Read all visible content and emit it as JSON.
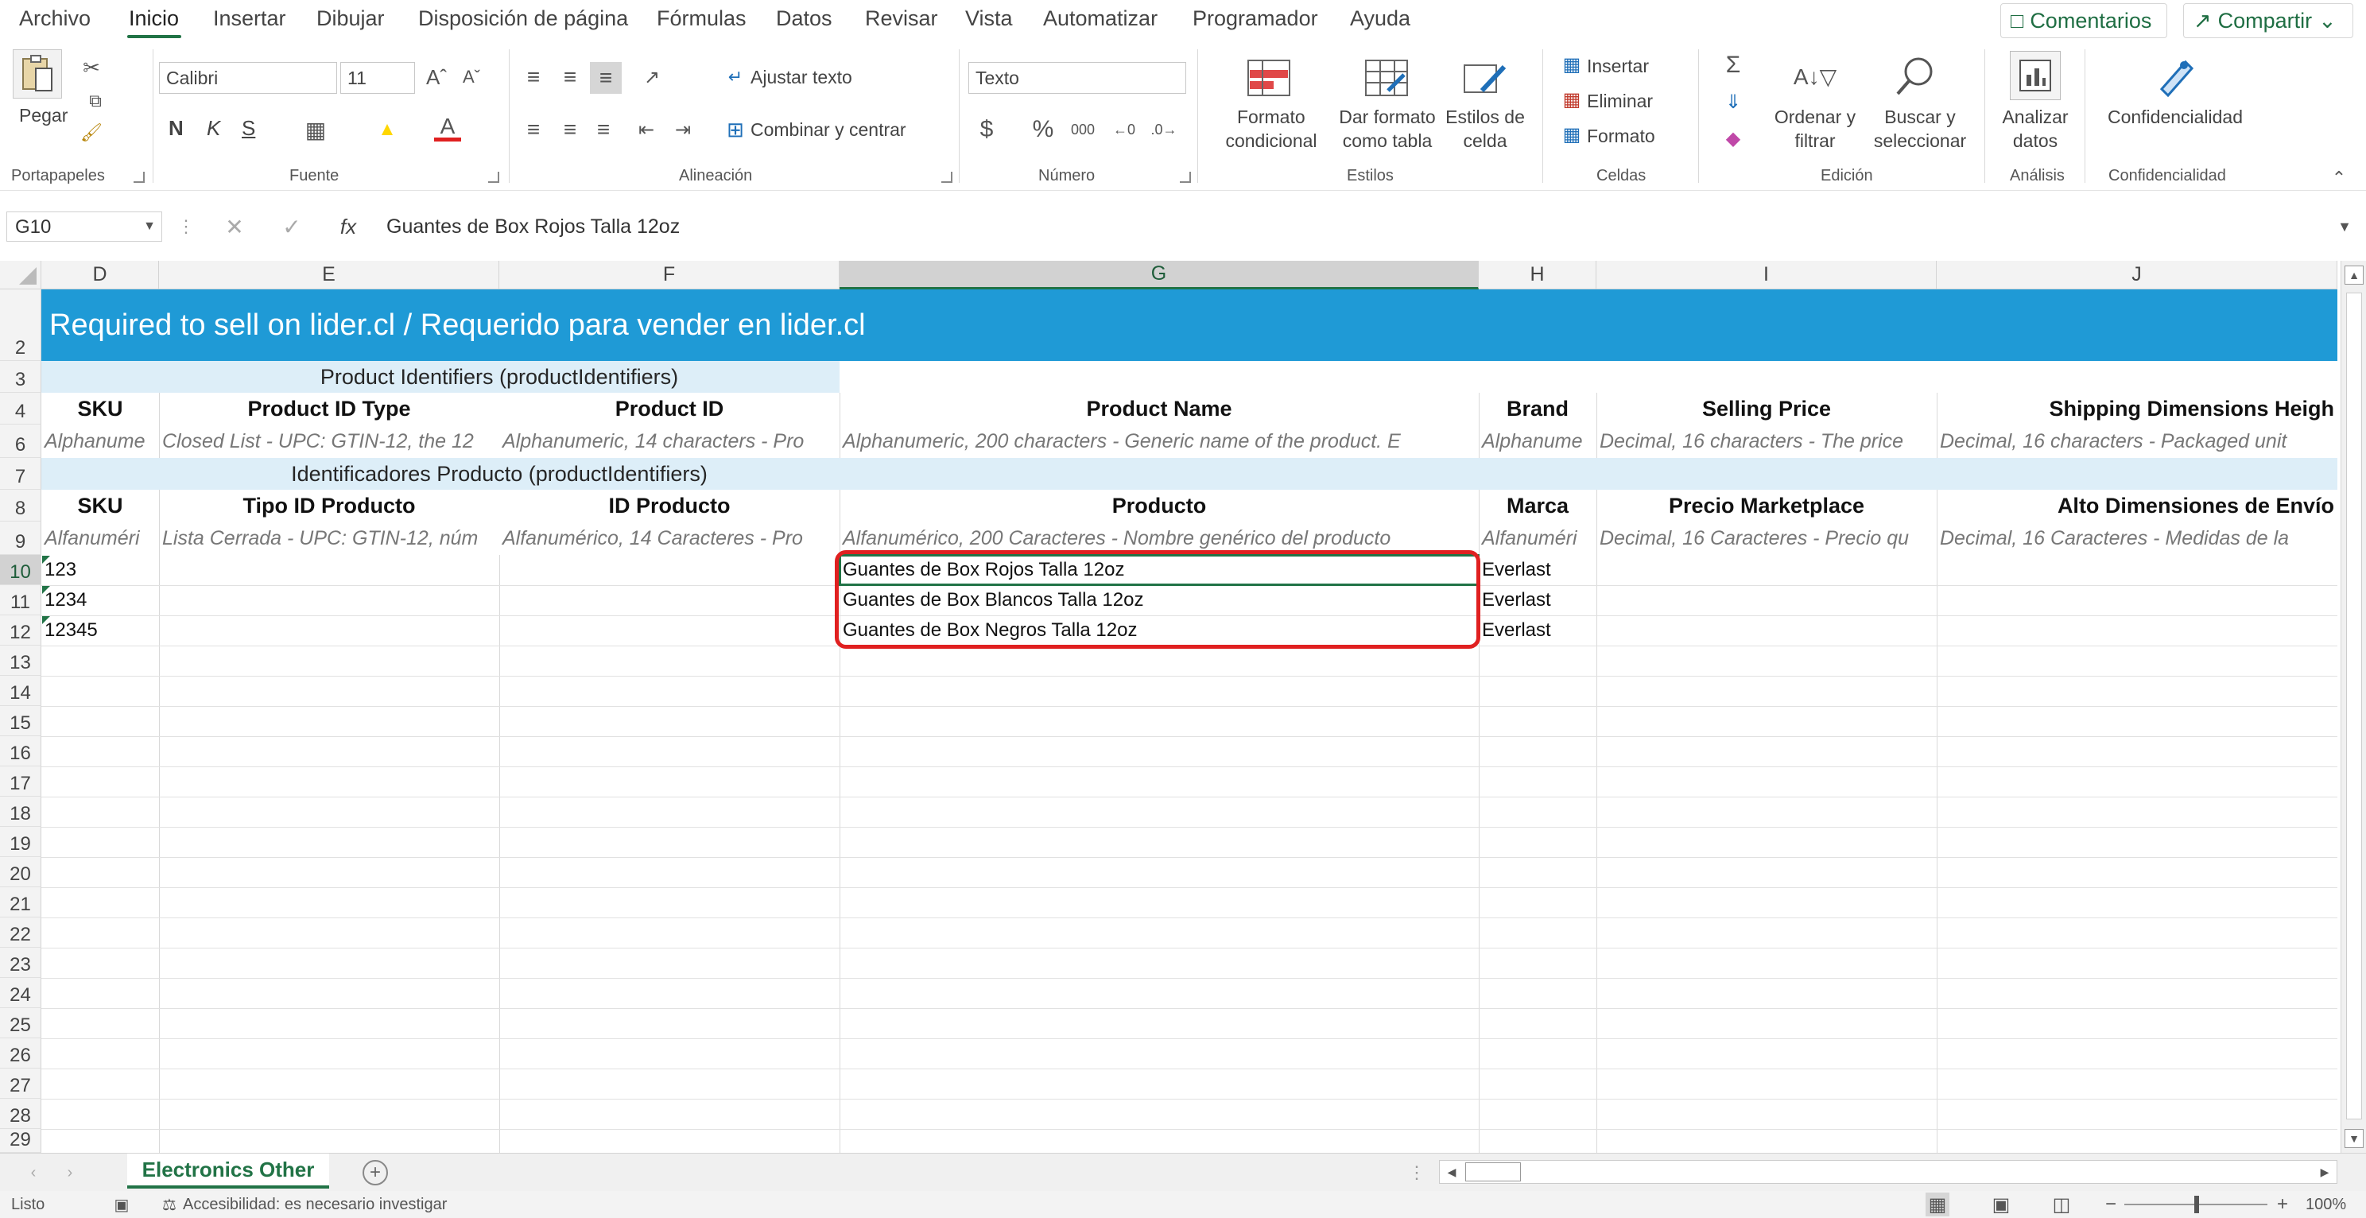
{
  "menu": {
    "items": [
      "Archivo",
      "Inicio",
      "Insertar",
      "Dibujar",
      "Disposición de página",
      "Fórmulas",
      "Datos",
      "Revisar",
      "Vista",
      "Automatizar",
      "Programador",
      "Ayuda"
    ],
    "comments_label": "Comentarios",
    "share_label": "Compartir"
  },
  "ribbon": {
    "clipboard": {
      "paste": "Pegar",
      "group": "Portapapeles"
    },
    "font": {
      "name": "Calibri",
      "size": "11",
      "bold": "N",
      "italic": "K",
      "underline": "S",
      "group": "Fuente"
    },
    "alignment": {
      "wrap": "Ajustar texto",
      "merge": "Combinar y centrar",
      "group": "Alineación"
    },
    "number": {
      "format": "Texto",
      "group": "Número"
    },
    "styles": {
      "cond1": "Formato",
      "cond2": "condicional",
      "table1": "Dar formato",
      "table2": "como tabla",
      "cell1": "Estilos de",
      "cell2": "celda",
      "group": "Estilos"
    },
    "cells": {
      "insert": "Insertar",
      "delete": "Eliminar",
      "format": "Formato",
      "group": "Celdas"
    },
    "editing": {
      "sort1": "Ordenar y",
      "sort2": "filtrar",
      "find1": "Buscar y",
      "find2": "seleccionar",
      "group": "Edición"
    },
    "analysis": {
      "btn1": "Analizar",
      "btn2": "datos",
      "group": "Análisis"
    },
    "sensitivity": {
      "btn": "Confidencialidad",
      "group": "Confidencialidad"
    }
  },
  "formula_bar": {
    "name_box": "G10",
    "content": "Guantes de Box Rojos Talla 12oz"
  },
  "columns": [
    "D",
    "E",
    "F",
    "G",
    "H",
    "I",
    "J"
  ],
  "rows": [
    "2",
    "3",
    "4",
    "6",
    "7",
    "8",
    "9",
    "10",
    "11",
    "12",
    "13",
    "14",
    "15",
    "16",
    "17",
    "18",
    "19",
    "20",
    "21",
    "22",
    "23",
    "24",
    "25",
    "26",
    "27",
    "28",
    "29"
  ],
  "banner": "Required to sell on lider.cl / Requerido para vender en lider.cl",
  "group_en": "Product Identifiers (productIdentifiers)",
  "group_es": "Identificadores Producto (productIdentifiers)",
  "headers_en": [
    "SKU",
    "Product ID Type",
    "Product ID",
    "Product Name",
    "Brand",
    "Selling Price",
    "Shipping Dimensions Heigh"
  ],
  "desc_en": [
    "Alphanume",
    "Closed List - UPC: GTIN-12, the 12",
    "Alphanumeric, 14 characters - Pro",
    "Alphanumeric, 200 characters - Generic name of the product. E",
    "Alphanume",
    "Decimal, 16 characters - The price",
    "Decimal, 16 characters - Packaged unit"
  ],
  "headers_es": [
    "SKU",
    "Tipo ID Producto",
    "ID Producto",
    "Producto",
    "Marca",
    "Precio Marketplace",
    "Alto Dimensiones de Envío"
  ],
  "desc_es": [
    "Alfanuméri",
    "Lista Cerrada - UPC: GTIN-12, núm",
    "Alfanumérico, 14 Caracteres - Pro",
    "Alfanumérico, 200 Caracteres - Nombre genérico del producto",
    "Alfanuméri",
    "Decimal, 16 Caracteres - Precio qu",
    "Decimal, 16 Caracteres - Medidas de la"
  ],
  "data_rows": [
    {
      "sku": "123",
      "product": "Guantes de Box Rojos Talla 12oz",
      "brand": "Everlast"
    },
    {
      "sku": "1234",
      "product": "Guantes de Box Blancos Talla 12oz",
      "brand": "Everlast"
    },
    {
      "sku": "12345",
      "product": "Guantes de Box Negros Talla 12oz",
      "brand": "Everlast"
    }
  ],
  "sheet_tab": "Electronics Other",
  "status": {
    "ready": "Listo",
    "accessibility": "Accesibilidad: es necesario investigar",
    "zoom": "100%"
  },
  "colors": {
    "accent": "#217346",
    "banner": "#1f9ad6",
    "group_fill": "#ddeef8",
    "highlight": "#e02020"
  }
}
